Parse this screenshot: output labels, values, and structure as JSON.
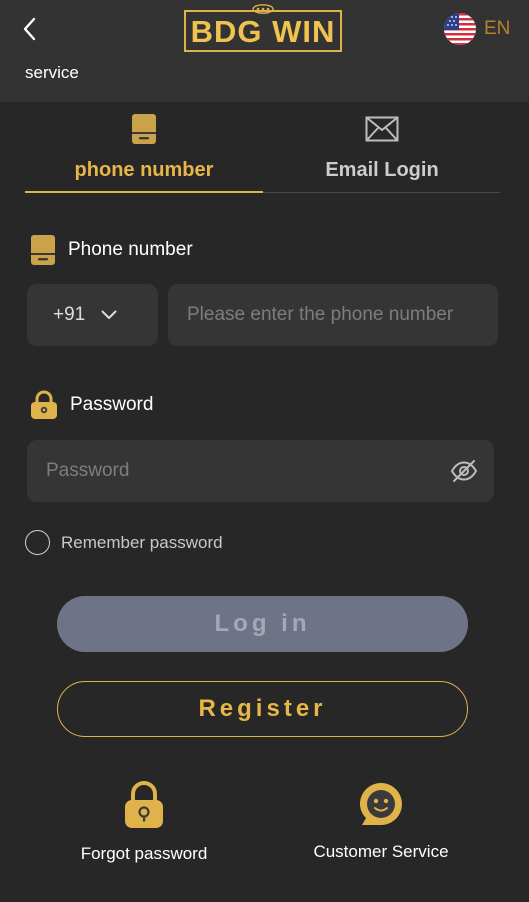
{
  "header": {
    "logo_text": "BDG WIN",
    "language": "EN",
    "service_label": "service"
  },
  "tabs": [
    {
      "label": "phone number",
      "icon": "phone-icon",
      "active": true
    },
    {
      "label": "Email Login",
      "icon": "mail-icon",
      "active": false
    }
  ],
  "phone_field": {
    "label": "Phone number",
    "country_code": "+91",
    "placeholder": "Please enter the phone number"
  },
  "password_field": {
    "label": "Password",
    "placeholder": "Password"
  },
  "remember_label": "Remember password",
  "login_label": "Log in",
  "register_label": "Register",
  "bottom_links": {
    "forgot": "Forgot password",
    "customer": "Customer Service"
  },
  "colors": {
    "accent": "#e0b34a",
    "background": "#272727",
    "header": "#333333",
    "input": "#353535",
    "login_button": "#6f7387"
  }
}
